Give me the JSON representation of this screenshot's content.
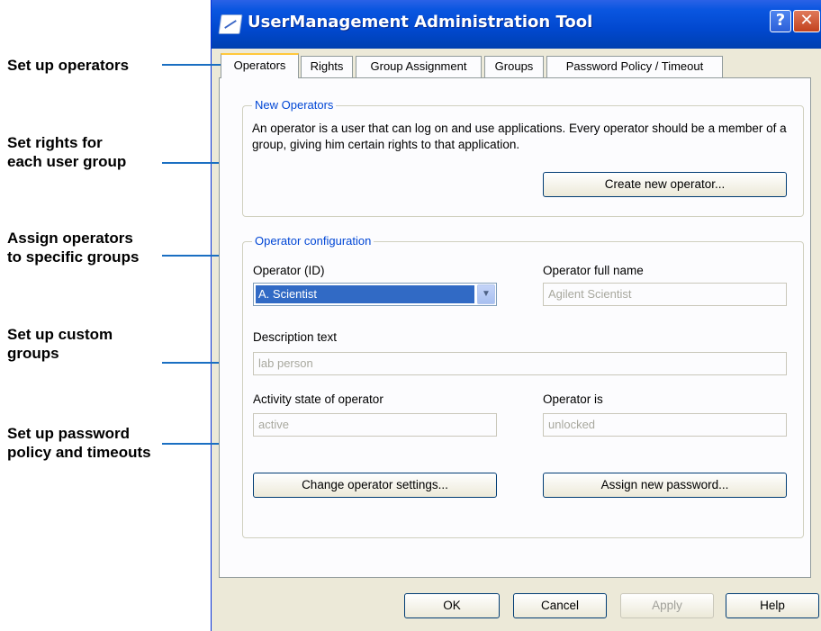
{
  "window": {
    "title": "UserManagement Administration Tool",
    "help_glyph": "?",
    "close_glyph": "✕"
  },
  "tabs": [
    {
      "label": "Operators",
      "active": true
    },
    {
      "label": "Rights"
    },
    {
      "label": "Group Assignment"
    },
    {
      "label": "Groups"
    },
    {
      "label": "Password Policy / Timeout"
    }
  ],
  "new_operators": {
    "legend": "New Operators",
    "description": "An operator is a user that can log on and use applications. Every operator should be a member of a group, giving him certain rights to that application.",
    "create_button": "Create new operator..."
  },
  "operator_config": {
    "legend": "Operator configuration",
    "operator_id_label": "Operator (ID)",
    "operator_id_value": "A. Scientist",
    "full_name_label": "Operator full name",
    "full_name_value": "Agilent Scientist",
    "description_label": "Description text",
    "description_value": "lab person",
    "activity_label": "Activity state of operator",
    "activity_value": "active",
    "lock_label": "Operator is",
    "lock_value": "unlocked",
    "change_button": "Change operator settings...",
    "password_button": "Assign new password..."
  },
  "footer": {
    "ok": "OK",
    "cancel": "Cancel",
    "apply": "Apply",
    "help": "Help"
  },
  "annotations": [
    "Set up operators",
    "Set rights for\neach user group",
    "Assign operators\nto specific groups",
    "Set up custom\ngroups",
    "Set up password\npolicy and timeouts"
  ],
  "colors": {
    "title_bar": "#0148cf",
    "selection": "#316ac5",
    "legend_text": "#0046d5",
    "callout_line": "#1a6fc2",
    "tab_highlight": "#ffc83c"
  }
}
